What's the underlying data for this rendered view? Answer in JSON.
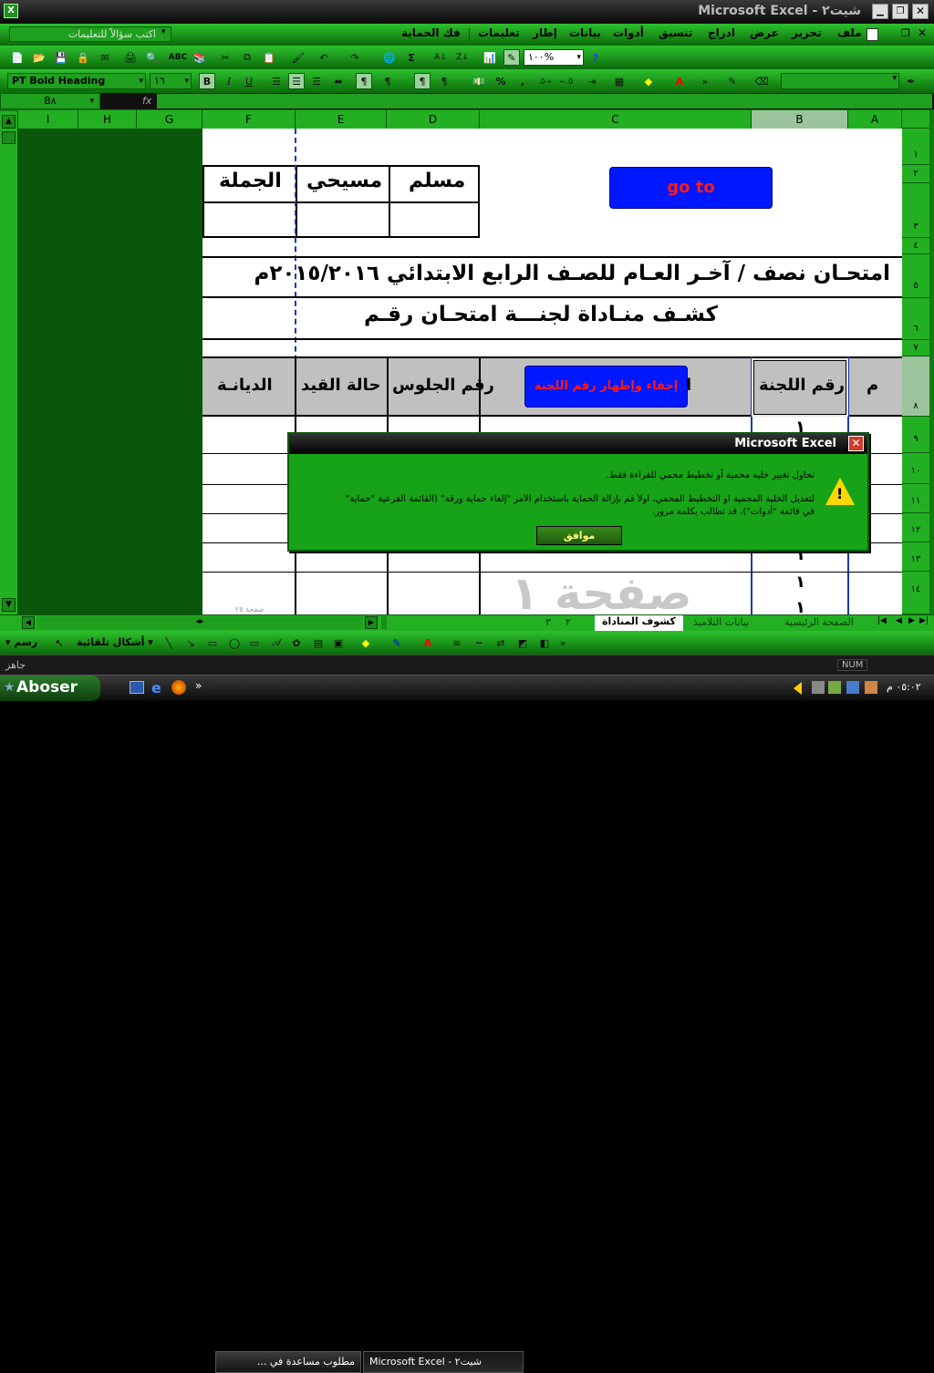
{
  "window": {
    "title": "Microsoft Excel - شيت٢"
  },
  "menubar": {
    "help_placeholder": "اكتب سؤالاً للتعليمات",
    "items": [
      "ملف",
      "تحرير",
      "عرض",
      "ادراج",
      "تنسيق",
      "أدوات",
      "بيانات",
      "إطار",
      "تعليمات",
      "فك الحماية"
    ]
  },
  "toolbar": {
    "zoom": "١٠٠%"
  },
  "format_bar": {
    "font_name": "PT Bold Heading",
    "font_size": "١٦",
    "bold": "B",
    "italic": "I",
    "underline": "U",
    "percent": "%",
    "comma": ","
  },
  "formula_bar": {
    "name_box": "B٨",
    "fx": "fx",
    "content": ""
  },
  "columns": [
    "A",
    "B",
    "C",
    "D",
    "E",
    "F",
    "G",
    "H",
    "I"
  ],
  "rows": [
    "١",
    "٢",
    "٣",
    "٤",
    "٥",
    "٦",
    "٧",
    "٨",
    "٩",
    "١٠",
    "١١",
    "١٢",
    "١٣",
    "١٤"
  ],
  "sheet": {
    "h_muslim": "مسلم",
    "h_christian": "مسيحي",
    "h_total": "الجملة",
    "goto_button": "go to",
    "exam_title": "امتحـان نصف / آخـر العـام للصـف الرابع الابتدائي ٢٠١٥/٢٠١٦م",
    "roll_title": "كشـف منـاداة لجنـــة امتحـان رقـم",
    "col_m": "م",
    "col_committee": "رقم اللجنة",
    "col_name_partial": "ا",
    "toggle_button": "إخفاء وإظهار رقم اللجنة",
    "col_seat": "رقم الجلوس",
    "col_status": "حالة القيد",
    "col_religion": "الديانـة",
    "committee_values": [
      "١",
      "١",
      "١",
      "١"
    ],
    "page_watermark": "صفحة ١",
    "small_page_label": "صفحة ٢٥"
  },
  "dialog": {
    "title": "Microsoft Excel",
    "line1": "تحاول تغيير خلية محمية أو تخطيط محمي للقراءة فقط.",
    "line2": "لتعديل الخلية المحمية أو التخطيط المحمي، أولاً قم بإزالة الحماية باستخدام الأمر \"إلغاء حماية ورقة\" (القائمة الفرعية \"حماية\"",
    "line3": "في قائمة \"أدوات\"). قد تطالب بكلمة مرور.",
    "ok": "موافق"
  },
  "tabs": [
    "الصفحة الرئيسية",
    "بيانات التلاميذ",
    "كشوف المناداة",
    "٢",
    "٣"
  ],
  "drawing_bar": {
    "draw": "رسم",
    "autoshapes": "أشكال تلقائية"
  },
  "status": {
    "ready": "جاهز",
    "num": "NUM"
  },
  "taskbar": {
    "start": "Aboser",
    "task1": "مطلوب مساعدة في ...",
    "task2": "Microsoft Excel - شيت٢",
    "clock": "٠٥:٠٢ م"
  },
  "colors": {
    "accent_green": "#22b022",
    "dark_green": "#0b5a0b",
    "blue_button": "#0018ff"
  }
}
